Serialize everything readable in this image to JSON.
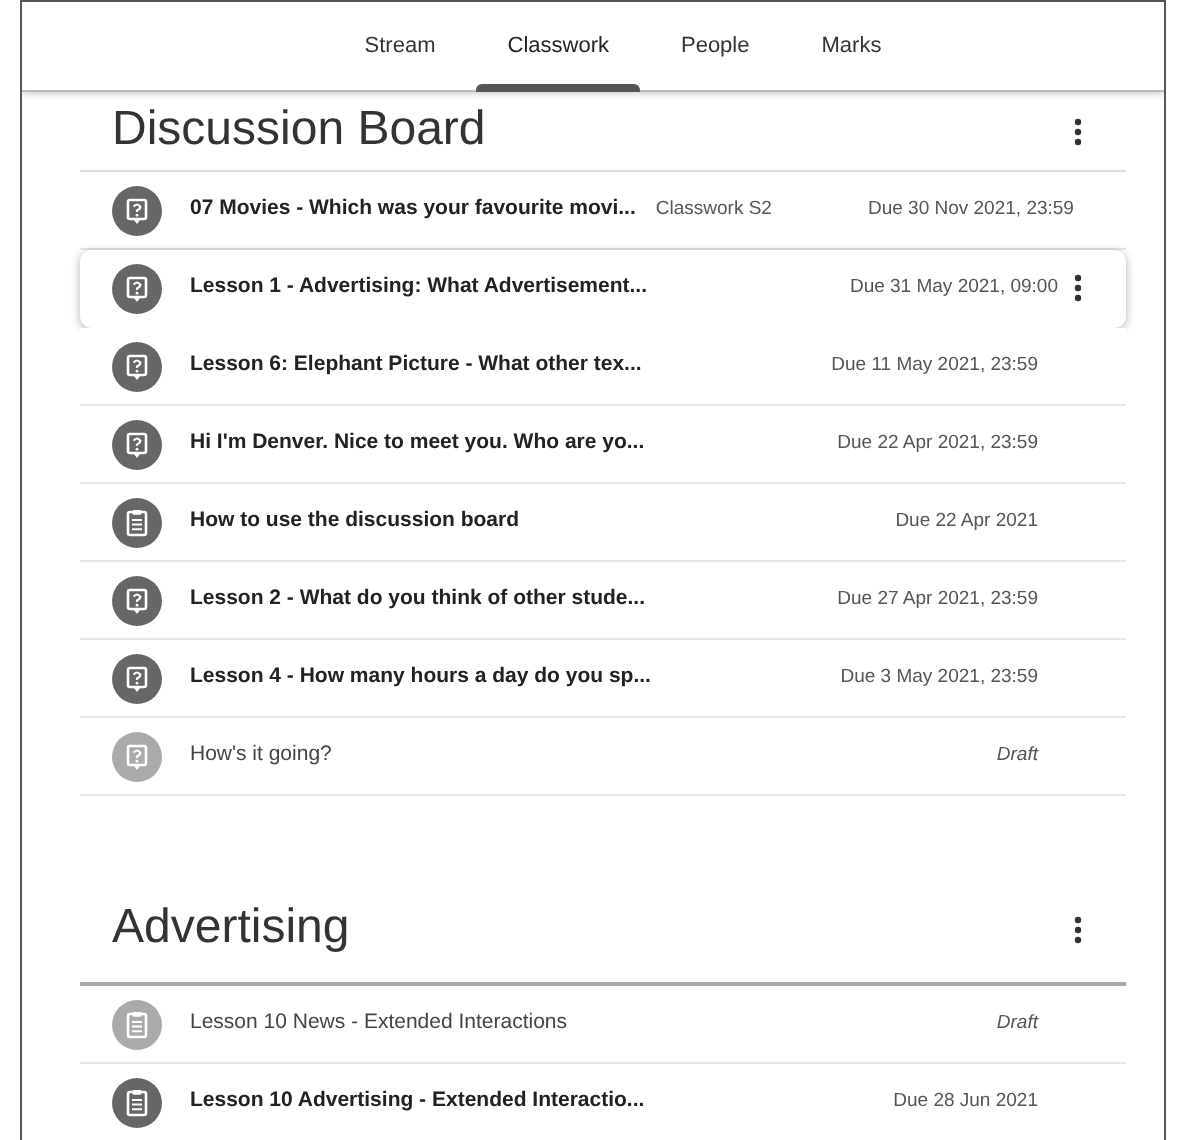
{
  "tabs": [
    {
      "label": "Stream",
      "selected": false
    },
    {
      "label": "Classwork",
      "selected": true
    },
    {
      "label": "People",
      "selected": false
    },
    {
      "label": "Marks",
      "selected": false
    }
  ],
  "sections": [
    {
      "title": "Discussion Board",
      "items": [
        {
          "kind": "question",
          "title": "07 Movies - Which was your favourite movi...",
          "topic": "Classwork S2",
          "due": "Due 30 Nov 2021, 23:59",
          "draft": false,
          "highlighted": false
        },
        {
          "kind": "question",
          "title": "Lesson 1 - Advertising: What Advertisement...",
          "due": "Due 31 May 2021, 09:00",
          "draft": false,
          "highlighted": true
        },
        {
          "kind": "question",
          "title": "Lesson 6: Elephant Picture - What other tex...",
          "due": "Due 11 May 2021, 23:59",
          "draft": false,
          "highlighted": false
        },
        {
          "kind": "question",
          "title": "Hi I'm Denver. Nice to meet you. Who are yo...",
          "due": "Due 22 Apr 2021, 23:59",
          "draft": false,
          "highlighted": false
        },
        {
          "kind": "material",
          "title": "How to use the discussion board",
          "due": "Due 22 Apr 2021",
          "draft": false,
          "highlighted": false
        },
        {
          "kind": "question",
          "title": "Lesson 2 - What do you think of other stude...",
          "due": "Due 27 Apr 2021, 23:59",
          "draft": false,
          "highlighted": false
        },
        {
          "kind": "question",
          "title": "Lesson 4 - How many hours a day do you sp...",
          "due": "Due 3 May 2021, 23:59",
          "draft": false,
          "highlighted": false
        },
        {
          "kind": "question",
          "title": "How's it going?",
          "due": "Draft",
          "draft": true,
          "highlighted": false
        }
      ]
    },
    {
      "title": "Advertising",
      "items": [
        {
          "kind": "material",
          "title": "Lesson 10 News - Extended Interactions",
          "due": "Draft",
          "draft": true,
          "highlighted": false
        },
        {
          "kind": "material",
          "title": "Lesson 10 Advertising - Extended Interactio...",
          "due": "Due 28 Jun 2021",
          "draft": false,
          "highlighted": false
        }
      ]
    }
  ]
}
